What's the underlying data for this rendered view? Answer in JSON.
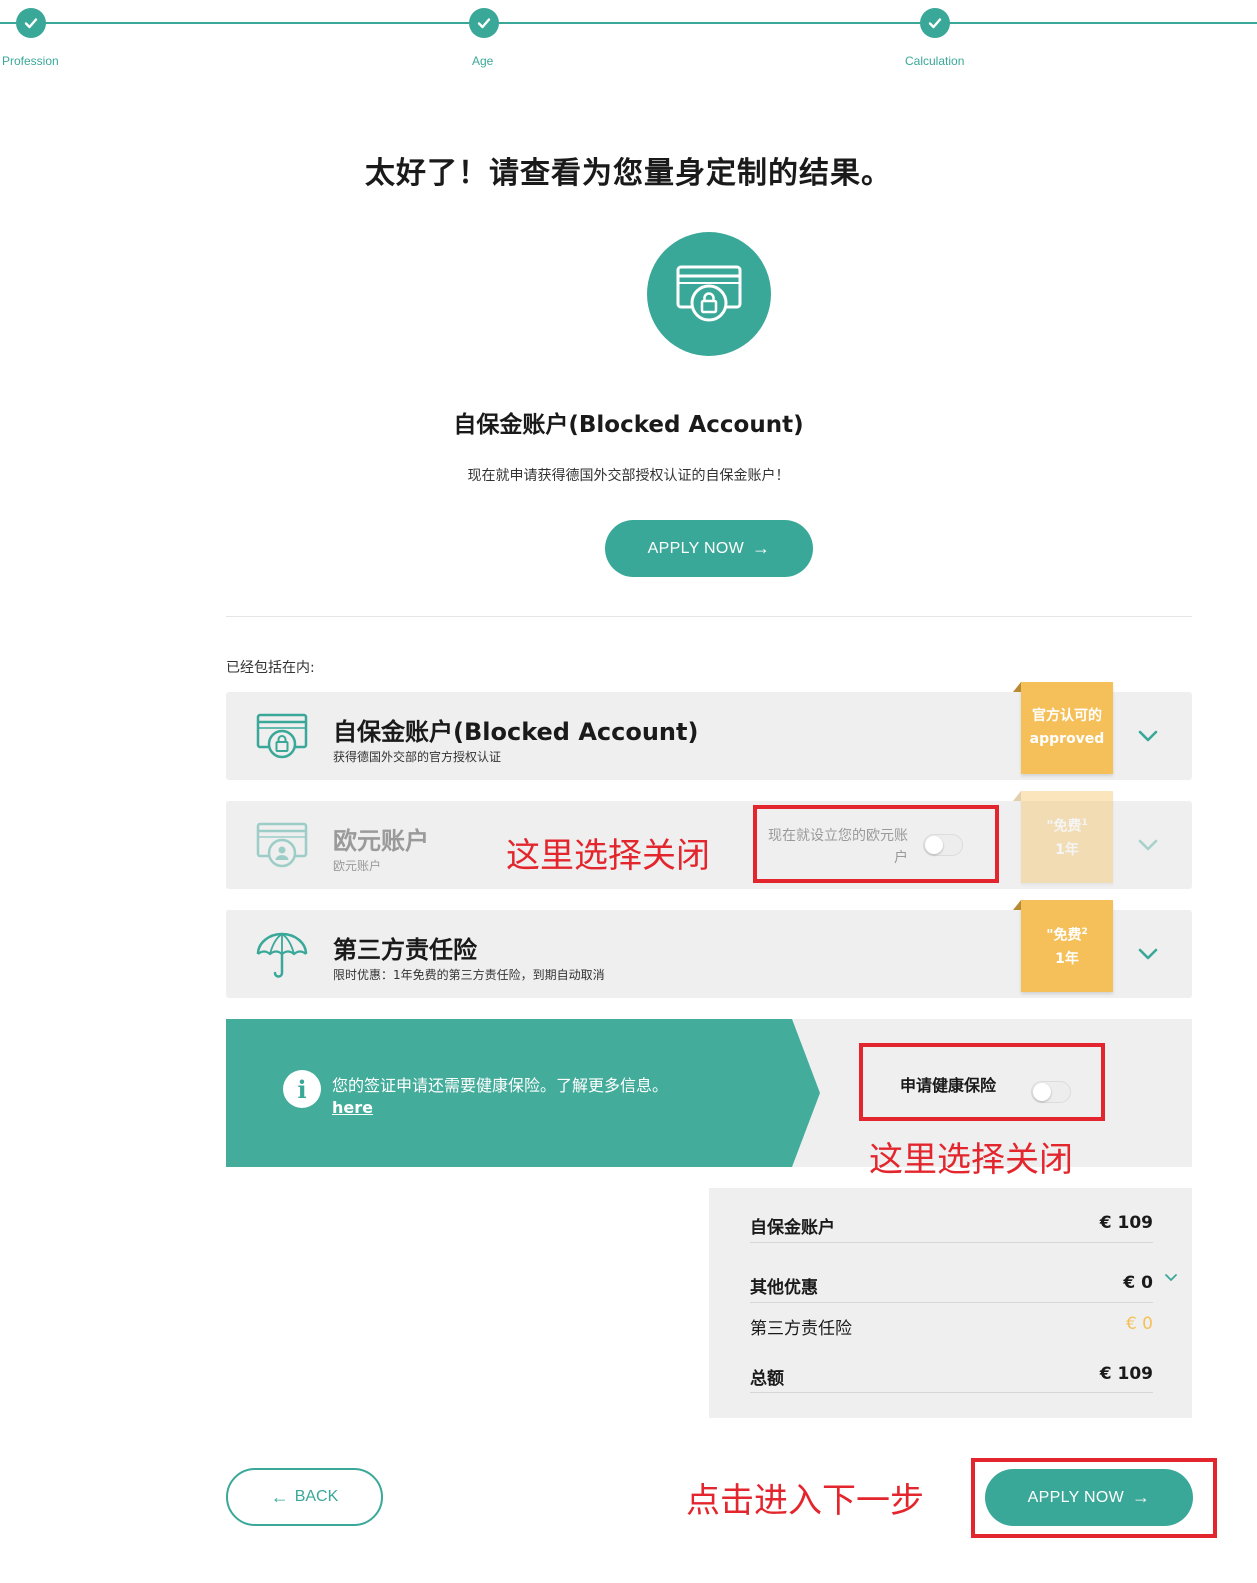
{
  "stepper": {
    "steps": [
      {
        "label": "Profession",
        "status": "completed"
      },
      {
        "label": "Age",
        "status": "completed"
      },
      {
        "label": "Calculation",
        "status": "completed"
      }
    ]
  },
  "result": {
    "title": "太好了！请查看为您量身定制的结果。",
    "product_icon": "blocked-account-card-lock-icon",
    "product_title": "自保金账户(Blocked Account)",
    "product_desc": "现在就申请获得德国外交部授权认证的自保金账户！",
    "apply_label": "APPLY NOW"
  },
  "included": {
    "label": "已经包括在内:",
    "cards": [
      {
        "title": "自保金账户(Blocked Account)",
        "subtitle": "获得德国外交部的官方授权认证",
        "icon": "blocked-account-icon",
        "badge_line1": "官方认可的",
        "badge_line2": "approved",
        "enabled": true
      },
      {
        "title": "欧元账户",
        "subtitle": "欧元账户",
        "icon": "euro-account-icon",
        "toggle_label": "现在就设立您的欧元账户",
        "toggle_on": false,
        "badge_line1": "\"免费",
        "badge_sup": "1",
        "badge_line2": "1年",
        "enabled": false
      },
      {
        "title": "第三方责任险",
        "subtitle": "限时优惠：1年免费的第三方责任险，到期自动取消",
        "icon": "umbrella-icon",
        "badge_line1": "\"免费",
        "badge_sup": "2",
        "badge_line2": "1年",
        "enabled": true
      }
    ]
  },
  "health_banner": {
    "text": "您的签证申请还需要健康保险。了解更多信息。",
    "link": "here",
    "toggle_label": "申请健康保险",
    "toggle_on": false
  },
  "annotations": {
    "euro_toggle_note": "这里选择关闭",
    "health_toggle_note": "这里选择关闭",
    "next_step_note": "点击进入下一步"
  },
  "summary": {
    "rows": [
      {
        "label": "自保金账户",
        "value": "€ 109",
        "bold": true
      },
      {
        "label": "其他优惠",
        "value": "€ 0",
        "bold": true
      },
      {
        "label": "第三方责任险",
        "value": "€ 0",
        "bold": false,
        "value_color": "#f5c05a"
      },
      {
        "label": "总额",
        "value": "€ 109",
        "bold": true
      }
    ]
  },
  "footer": {
    "back_label": "BACK",
    "apply_label": "APPLY NOW"
  },
  "colors": {
    "teal": "#3aa898",
    "badge_yellow": "#f5c05a",
    "card_gray": "#efefef",
    "annotation_red": "#e3262d"
  }
}
